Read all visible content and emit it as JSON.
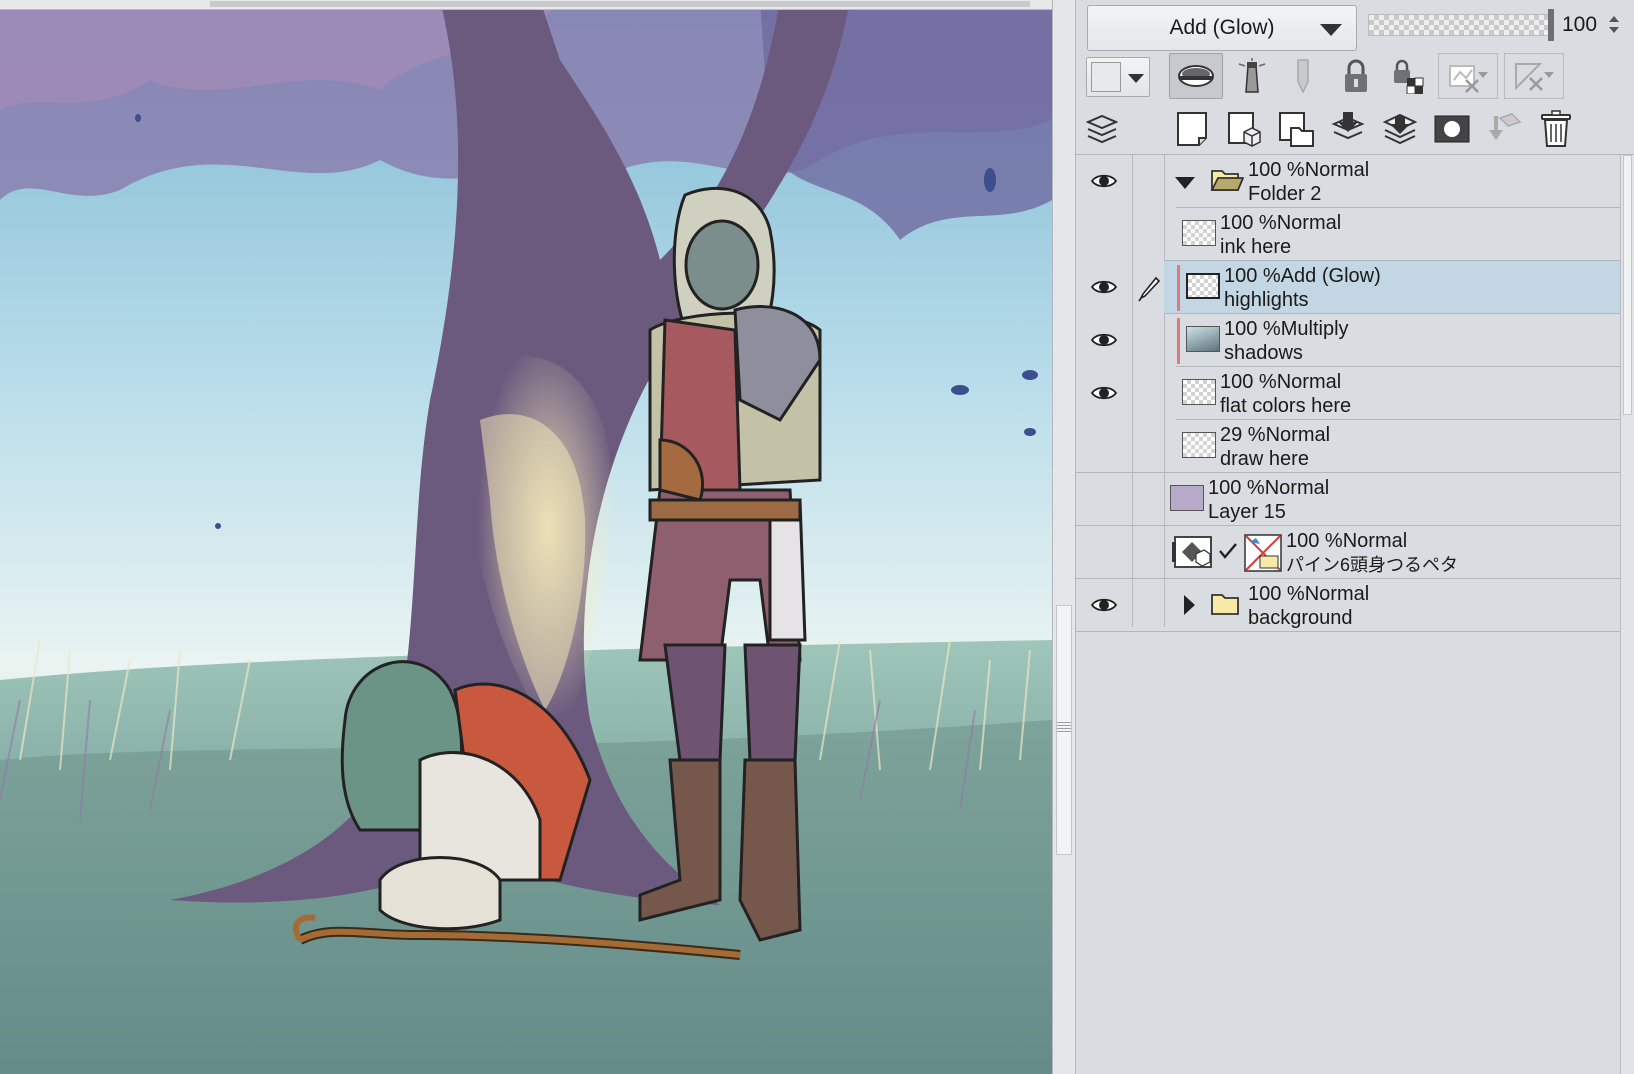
{
  "blend_mode": {
    "selected": "Add (Glow)"
  },
  "opacity": {
    "value": "100",
    "level_percent": 100
  },
  "layers": [
    {
      "opacity": "100 %",
      "mode": "Normal",
      "name": "Folder 2",
      "visible": true,
      "type": "folder",
      "expanded": true
    },
    {
      "opacity": "100 %",
      "mode": "Normal",
      "name": "ink here",
      "visible": false,
      "type": "raster"
    },
    {
      "opacity": "100 %",
      "mode": "Add (Glow)",
      "name": "highlights",
      "visible": true,
      "type": "raster",
      "selected": true,
      "clipped": true
    },
    {
      "opacity": "100 %",
      "mode": "Multiply",
      "name": "shadows",
      "visible": true,
      "type": "raster",
      "clipped": true
    },
    {
      "opacity": "100 %",
      "mode": "Normal",
      "name": "flat colors here",
      "visible": true,
      "type": "raster"
    },
    {
      "opacity": "29 %",
      "mode": "Normal",
      "name": "draw here",
      "visible": false,
      "type": "raster"
    },
    {
      "opacity": "100 %",
      "mode": "Normal",
      "name": "Layer 15",
      "visible": false,
      "type": "fill"
    },
    {
      "opacity": "100 %",
      "mode": "Normal",
      "name": "パイン6頭身つるペタ",
      "visible": false,
      "type": "3d-model"
    },
    {
      "opacity": "100 %",
      "mode": "Normal",
      "name": "background",
      "visible": true,
      "type": "folder",
      "expanded": false
    }
  ],
  "icons": {
    "toolbar_row1": [
      "color-swatch-icon",
      "clip-to-layer-below-icon",
      "reference-layer-icon",
      "draft-layer-icon",
      "lock-layer-icon",
      "lock-transparent-icon",
      "mask-enable-icon",
      "ruler-display-icon"
    ],
    "toolbar_row2": [
      "layer-stack-icon",
      "new-raster-layer-icon",
      "new-vector-layer-icon",
      "new-folder-icon",
      "transfer-down-icon",
      "merge-down-icon",
      "layer-mask-icon",
      "apply-mask-icon",
      "delete-layer-icon"
    ]
  },
  "colors": {
    "panel_bg": "#d9dce1",
    "selected_row": "#c3d6e3",
    "clip_indicator": "#e07a7a",
    "layer15_fill": "#b7a9c8"
  }
}
